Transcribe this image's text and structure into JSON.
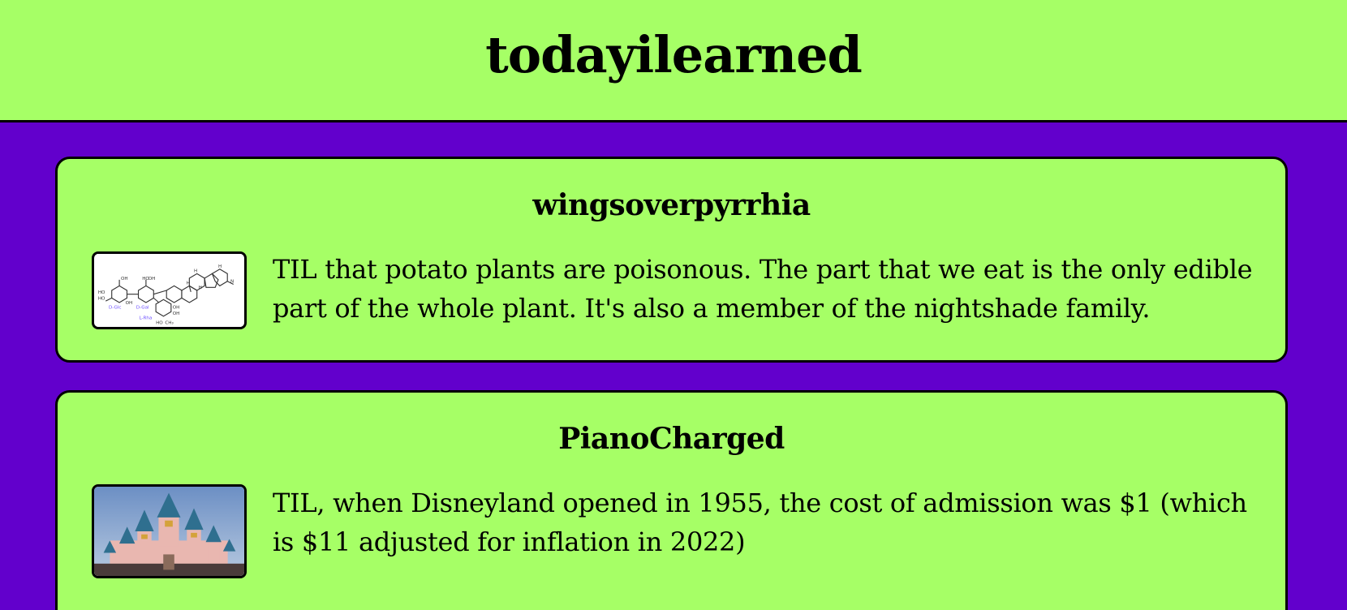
{
  "header": {
    "title": "todayilearned"
  },
  "posts": [
    {
      "author": "wingsoverpyrrhia",
      "text": "TIL that potato plants are poisonous. The part that we eat is the only edible part of the whole plant. It's also a member of the nightshade family.",
      "thumbnail": "molecule-structure-image"
    },
    {
      "author": "PianoCharged",
      "text": "TIL, when Disneyland opened in 1955, the cost of admission was $1 (which is $11 adjusted for inflation in 2022)",
      "thumbnail": "castle-photo-image"
    }
  ],
  "colors": {
    "background": "#6200CC",
    "card": "#A6FF66",
    "border": "#000000"
  }
}
